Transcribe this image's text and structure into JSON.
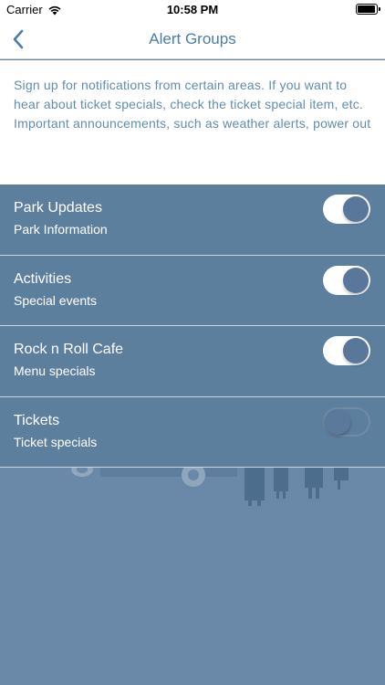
{
  "status_bar": {
    "carrier": "Carrier",
    "time": "10:58 PM"
  },
  "nav": {
    "title": "Alert Groups",
    "back_icon": "chevron-left-icon"
  },
  "intro": {
    "line1": "Sign up for notifications from certain areas. If you want to hear about ticket specials, check the ticket special item, etc.",
    "line2a": "Important announcements, such as weather alerts, power outages, etc, will always be sent to everyone in the Bran"
  },
  "groups": [
    {
      "title": "Park Updates",
      "subtitle": "Park Information",
      "enabled": true
    },
    {
      "title": "Activities",
      "subtitle": "Special events",
      "enabled": true
    },
    {
      "title": "Rock n Roll Cafe",
      "subtitle": "Menu specials",
      "enabled": true
    },
    {
      "title": "Tickets",
      "subtitle": "Ticket specials",
      "enabled": false
    }
  ],
  "colors": {
    "accent": "#4a7da8",
    "row_background": "#5d7f9e",
    "page_background": "#6a88a8"
  }
}
